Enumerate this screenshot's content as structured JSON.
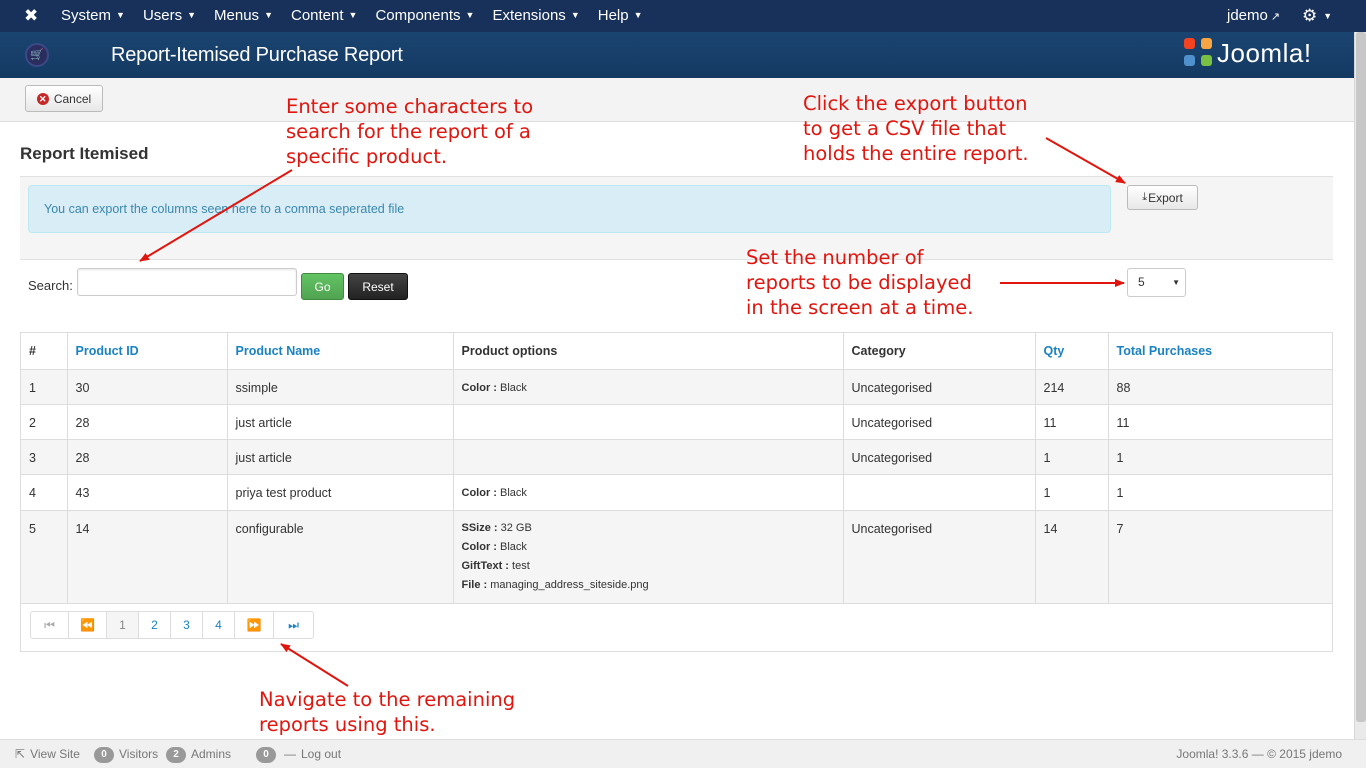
{
  "nav": {
    "menu": [
      "System",
      "Users",
      "Menus",
      "Content",
      "Components",
      "Extensions",
      "Help"
    ],
    "user": "jdemo"
  },
  "header": {
    "title": "Report-Itemised Purchase Report",
    "brand": "Joomla!"
  },
  "toolbar": {
    "cancel_label": "Cancel"
  },
  "page": {
    "title": "Report Itemised"
  },
  "export": {
    "info": "You can export the columns seen here to a comma seperated file",
    "button_label": "Export"
  },
  "search": {
    "label": "Search:",
    "value": "",
    "go_label": "Go",
    "reset_label": "Reset"
  },
  "limit": {
    "value": "5"
  },
  "table": {
    "headers": [
      "#",
      "Product ID",
      "Product Name",
      "Product options",
      "Category",
      "Qty",
      "Total Purchases"
    ],
    "rows": [
      {
        "num": "1",
        "product_id": "30",
        "name": "ssimple",
        "options": [
          {
            "k": "Color :",
            "v": "Black"
          }
        ],
        "category": "Uncategorised",
        "qty": "214",
        "total": "88"
      },
      {
        "num": "2",
        "product_id": "28",
        "name": "just article",
        "options": [],
        "category": "Uncategorised",
        "qty": "11",
        "total": "11"
      },
      {
        "num": "3",
        "product_id": "28",
        "name": "just article",
        "options": [],
        "category": "Uncategorised",
        "qty": "1",
        "total": "1"
      },
      {
        "num": "4",
        "product_id": "43",
        "name": "priya test product",
        "options": [
          {
            "k": "Color :",
            "v": "Black"
          }
        ],
        "category": "",
        "qty": "1",
        "total": "1"
      },
      {
        "num": "5",
        "product_id": "14",
        "name": "configurable",
        "options": [
          {
            "k": "SSize :",
            "v": "32 GB"
          },
          {
            "k": "Color :",
            "v": "Black"
          },
          {
            "k": "GiftText :",
            "v": "test"
          },
          {
            "k": "File :",
            "v": "managing_address_siteside.png"
          }
        ],
        "category": "Uncategorised",
        "qty": "14",
        "total": "7"
      }
    ]
  },
  "pagination": {
    "pages": [
      "1",
      "2",
      "3",
      "4"
    ],
    "current": "1"
  },
  "annotations": {
    "search": [
      "Enter some characters to",
      "search for the report of a",
      "specific product."
    ],
    "export": [
      "Click the export button",
      "to get a CSV file that",
      "holds the entire report."
    ],
    "limit": [
      "Set the number of",
      "reports to be displayed",
      "in the screen at a time."
    ],
    "pager": [
      "Navigate to the remaining",
      "reports using this."
    ]
  },
  "footer": {
    "view_site": "View Site",
    "visitors_count": "0",
    "visitors_label": "Visitors",
    "admins_count": "2",
    "admins_label": "Admins",
    "messages_count": "0",
    "logout": "Log out",
    "copyright": "Joomla! 3.3.6  —  © 2015 jdemo"
  },
  "colors": {
    "navbar": "#17315a",
    "header": "#1a4470",
    "link": "#1a82c3",
    "annotation": "#e0150e",
    "go": "#51a351"
  }
}
